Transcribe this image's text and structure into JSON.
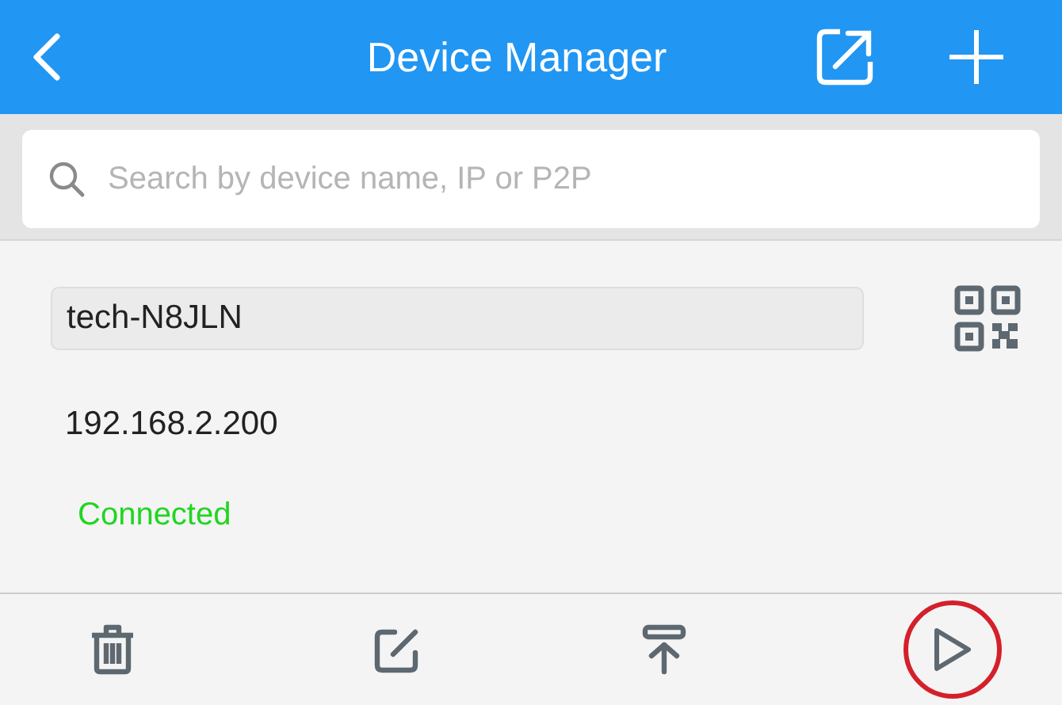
{
  "header": {
    "title": "Device Manager"
  },
  "search": {
    "placeholder": "Search by device name, IP or P2P"
  },
  "device": {
    "name": "tech-N8JLN",
    "ip": "192.168.2.200",
    "status": "Connected",
    "connected": true
  },
  "actions": [
    {
      "kind": "delete",
      "highlighted": false
    },
    {
      "kind": "edit",
      "highlighted": false
    },
    {
      "kind": "top",
      "highlighted": false
    },
    {
      "kind": "play",
      "highlighted": true
    }
  ]
}
